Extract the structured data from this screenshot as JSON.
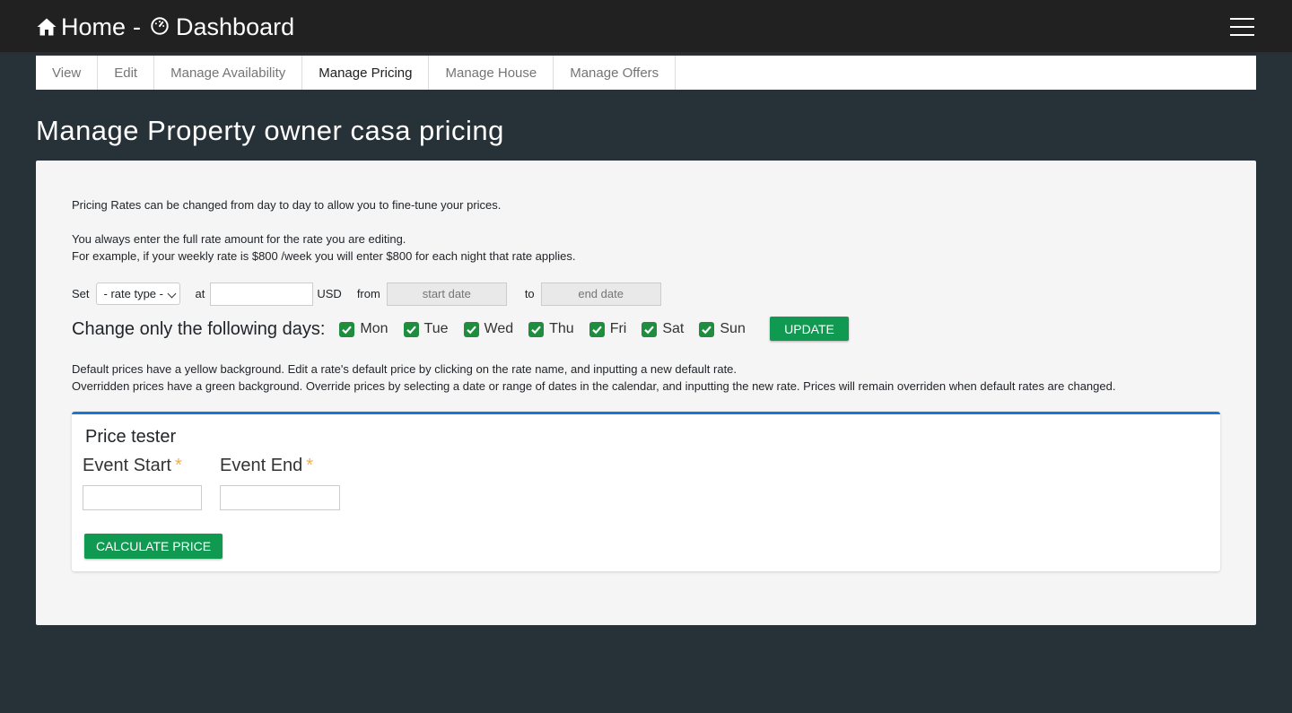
{
  "header": {
    "home_label": "Home",
    "separator": "-",
    "dashboard_label": "Dashboard"
  },
  "tabs": [
    {
      "label": "View",
      "active": false
    },
    {
      "label": "Edit",
      "active": false
    },
    {
      "label": "Manage Availability",
      "active": false
    },
    {
      "label": "Manage Pricing",
      "active": true
    },
    {
      "label": "Manage House",
      "active": false
    },
    {
      "label": "Manage Offers",
      "active": false
    }
  ],
  "page_title": "Manage Property owner casa pricing",
  "intro": {
    "line1": "Pricing Rates can be changed from day to day to allow you to fine-tune your prices.",
    "line2": "You always enter the full rate amount for the rate you are editing.",
    "line3": "For example, if your weekly rate is $800 /week you will enter $800 for each night that rate applies."
  },
  "rate_form": {
    "set_label": "Set",
    "rate_type_selected": "- rate type -",
    "at_label": "at",
    "rate_value": "",
    "currency": "USD",
    "from_label": "from",
    "start_placeholder": "start date",
    "to_label": "to",
    "end_placeholder": "end date"
  },
  "days": {
    "label": "Change only the following days:",
    "items": [
      {
        "label": "Mon",
        "checked": true
      },
      {
        "label": "Tue",
        "checked": true
      },
      {
        "label": "Wed",
        "checked": true
      },
      {
        "label": "Thu",
        "checked": true
      },
      {
        "label": "Fri",
        "checked": true
      },
      {
        "label": "Sat",
        "checked": true
      },
      {
        "label": "Sun",
        "checked": true
      }
    ],
    "update_label": "UPDATE"
  },
  "notes": {
    "default_note": "Default prices have a yellow background. Edit a rate's default price by clicking on the rate name, and inputting a new default rate.",
    "override_note": "Overridden prices have a green background. Override prices by selecting a date or range of dates in the calendar, and inputting the new rate. Prices will remain overriden when default rates are changed."
  },
  "price_tester": {
    "title": "Price tester",
    "event_start_label": "Event Start",
    "event_end_label": "Event End",
    "required_mark": "*",
    "calculate_label": "CALCULATE PRICE"
  },
  "colors": {
    "background": "#263238",
    "topbar": "#212121",
    "accent_green": "#109951",
    "tester_border": "#1976d2",
    "required": "#f0ad4e"
  }
}
